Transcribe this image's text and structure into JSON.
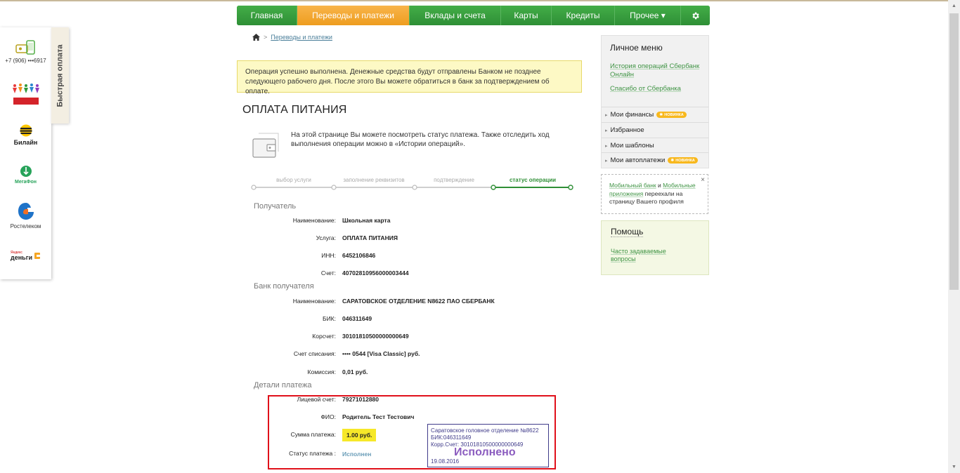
{
  "nav": {
    "items": [
      "Главная",
      "Переводы и платежи",
      "Вклады и счета",
      "Карты",
      "Кредиты",
      "Прочее ▾"
    ],
    "gear_icon": "gear-icon"
  },
  "quickpay": {
    "tab_label": "Быстрая оплата",
    "phone": "+7 (906) •••6917",
    "beeline": "Билайн",
    "megafon": "МегаФон",
    "rostelecom": "Ростелеком",
    "yandex_small": "Яндекс",
    "yandex_money": "деньги"
  },
  "breadcrumb": {
    "link": "Переводы и платежи",
    "sep": ">"
  },
  "success_message": "Операция успешно выполнена. Денежные средства будут отправлены Банком не позднее следующего рабочего дня. После этого Вы можете обратиться в банк за подтверждением об оплате.",
  "page_title": "ОПЛАТА ПИТАНИЯ",
  "info_text": "На этой странице Вы можете посмотреть статус платежа. Также отследить ход выполнения операции можно в «Истории операций».",
  "steps": [
    "выбор услуги",
    "заполнение реквизитов",
    "подтверждение",
    "статус операции"
  ],
  "recipient": {
    "heading": "Получатель",
    "rows": [
      {
        "label": "Наименование:",
        "value": "Школьная карта"
      },
      {
        "label": "Услуга:",
        "value": "ОПЛАТА ПИТАНИЯ"
      },
      {
        "label": "ИНН:",
        "value": "6452106846"
      },
      {
        "label": "Счет:",
        "value": "40702810956000003444"
      }
    ]
  },
  "bank": {
    "heading": "Банк получателя",
    "rows": [
      {
        "label": "Наименование:",
        "value": "САРАТОВСКОЕ ОТДЕЛЕНИЕ N8622 ПАО СБЕРБАНК"
      },
      {
        "label": "БИК:",
        "value": "046311649"
      },
      {
        "label": "Корсчет:",
        "value": "30101810500000000649"
      },
      {
        "label": "Счет списания:",
        "value": "•••• 0544  [Visa Classic]  руб."
      },
      {
        "label": "Комиссия:",
        "value": "0,01 руб."
      }
    ]
  },
  "details": {
    "heading": "Детали платежа",
    "account_label": "Лицевой счет:",
    "account_value": "79271012880",
    "fio_label": "ФИО:",
    "fio_value": "Родитель Тест Тестович",
    "sum_label": "Сумма платежа:",
    "sum_value": "1.00 руб.",
    "status_label": "Статус платежа :",
    "status_value": "Исполнен"
  },
  "stamp": {
    "line1": "Саратовское головное отделение №8622",
    "line2": "БИК:046311649",
    "line3": "Корр.Счет: 30101810500000000649",
    "status": "Исполнено",
    "date": "19.08.2016"
  },
  "sidebar": {
    "title": "Личное меню",
    "link1": "История операций Сбербанк Онлайн",
    "link2": "Спасибо от Сбербанка",
    "rows": [
      "Мои финансы",
      "Избранное",
      "Мои шаблоны",
      "Мои автоплатежи"
    ],
    "badge": "НОВИНКА"
  },
  "notice": {
    "link1": "Мобильный банк",
    "and": " и ",
    "link2": "Мобильные приложения",
    "text": " переехали на страницу Вашего профиля",
    "close": "×"
  },
  "help": {
    "title": "Помощь",
    "link": "Часто задаваемые вопросы"
  },
  "colors": {
    "green": "#2f9a3a",
    "orange": "#ee9d1f",
    "red_frame": "#e0101a",
    "stamp": "#403c8a"
  }
}
